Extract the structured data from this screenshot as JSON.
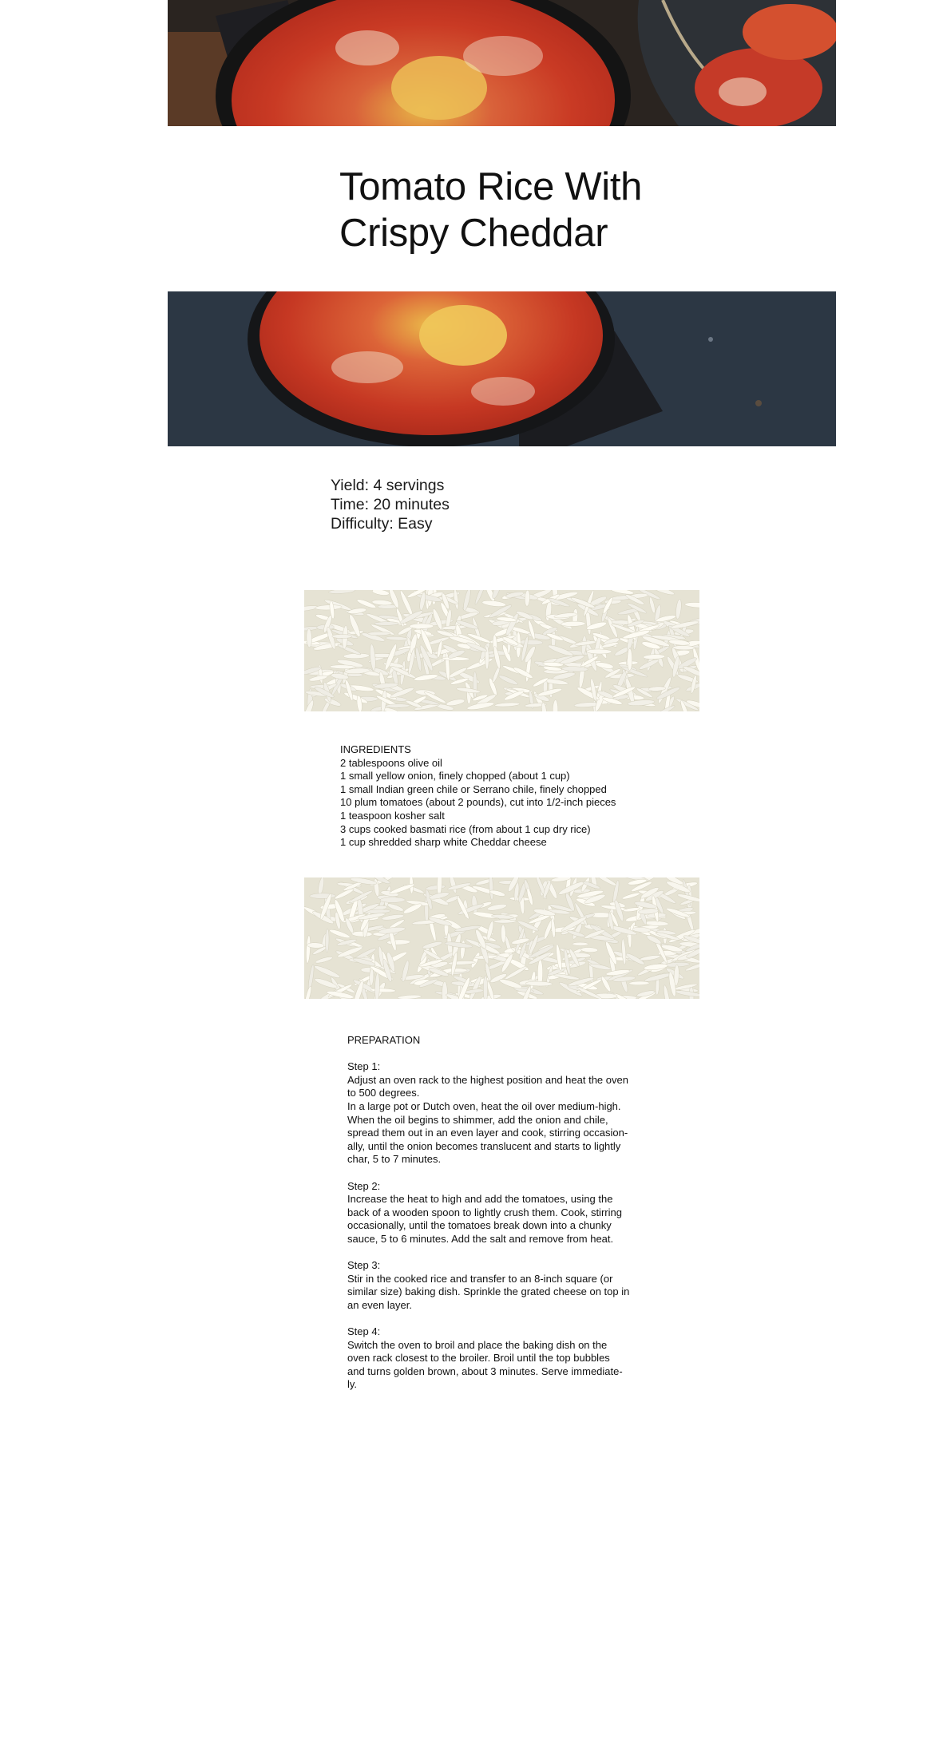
{
  "recipe": {
    "title_line1": "Tomato Rice With",
    "title_line2": "Crispy Cheddar",
    "yield": "Yield: 4 servings",
    "time": "Time: 20 minutes",
    "difficulty": "Difficulty: Easy"
  },
  "ingredients": {
    "heading": "INGREDIENTS",
    "items": [
      "2 tablespoons olive oil",
      "1 small yellow onion, finely chopped (about 1 cup)",
      "1 small Indian green chile or Serrano chile, finely chopped",
      "10 plum tomatoes (about 2 pounds), cut into 1/2-inch pieces",
      "1 teaspoon kosher salt",
      "3 cups cooked basmati rice (from about 1 cup dry rice)",
      "1 cup shredded sharp white Cheddar cheese"
    ]
  },
  "preparation": {
    "heading": "PREPARATION",
    "steps": [
      {
        "label": "Step 1:",
        "text": "Adjust an oven rack to the highest position and heat the oven\nto 500 degrees.\nIn a large pot or Dutch oven, heat the oil over medium-high.\nWhen the oil begins to shimmer, add the onion and chile,\nspread them out in an even layer and cook, stirring occasion-\nally, until the onion becomes translucent and starts to lightly\nchar, 5 to 7 minutes."
      },
      {
        "label": "Step 2:",
        "text": "Increase the heat to high and add the tomatoes, using the\nback of a wooden spoon to lightly crush them. Cook, stirring\noccasionally, until the tomatoes break down into a chunky\nsauce, 5 to 6 minutes. Add the salt and remove from heat."
      },
      {
        "label": "Step 3:",
        "text": "Stir in the cooked rice and transfer to an 8-inch square (or\nsimilar size) baking dish. Sprinkle the grated cheese on top in\nan even layer."
      },
      {
        "label": "Step 4:",
        "text": "Switch the oven to broil and place the baking dish on the\noven rack closest to the broiler. Broil until the top bubbles\nand turns golden brown, about 3 minutes. Serve immediate-\nly."
      }
    ]
  },
  "images": {
    "top_photo": "tomato-rice-dish-photo",
    "middle_photo": "tomato-rice-skillet-photo",
    "rice_texture": "basmati-rice-texture"
  },
  "colors": {
    "text": "#111111",
    "tomato": "#c8321e",
    "cheese": "#e8b23a",
    "rice": "#f3f1e8"
  }
}
